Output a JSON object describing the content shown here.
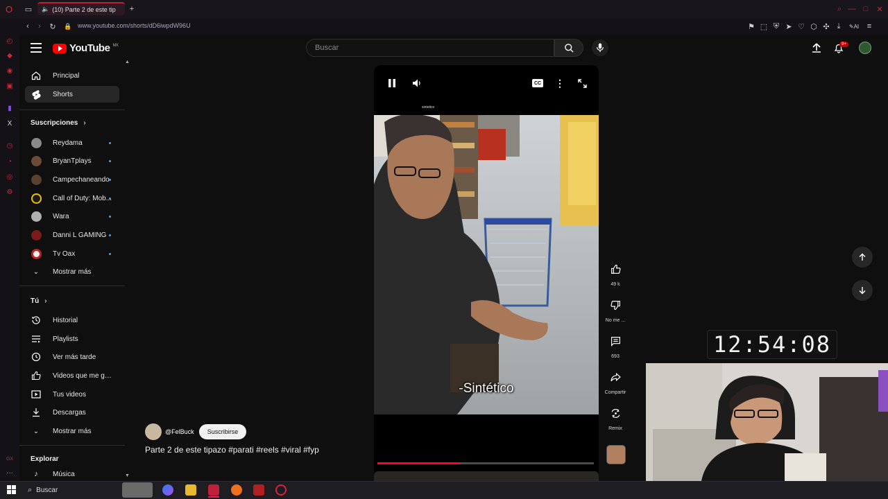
{
  "browser": {
    "tab_title": "(10) Parte 2 de este tip",
    "url": "www.youtube.com/shorts/dD6iwpdW96U"
  },
  "youtube": {
    "logo_text": "YouTube",
    "region": "MX",
    "search_placeholder": "Buscar",
    "notif_badge": "9+"
  },
  "sidebar": {
    "main": [
      {
        "label": "Principal",
        "icon": "home-icon"
      },
      {
        "label": "Shorts",
        "icon": "shorts-icon",
        "active": true
      }
    ],
    "subs_title": "Suscripciones",
    "subs": [
      {
        "label": "Reydama",
        "color": "#8a8a8a"
      },
      {
        "label": "BryanTplays",
        "color": "#6b4a3a"
      },
      {
        "label": "Campechaneando",
        "color": "#5a4030"
      },
      {
        "label": "Call of Duty: Mob...",
        "color": "#e8c400"
      },
      {
        "label": "Wara",
        "color": "#b0b0b0"
      },
      {
        "label": "Danni L GAMING",
        "color": "#7a1a1a"
      },
      {
        "label": "Tv Oax",
        "color": "#f0f0f0"
      }
    ],
    "show_more_1": "Mostrar más",
    "you_title": "Tú",
    "you": [
      {
        "label": "Historial",
        "icon": "history-icon"
      },
      {
        "label": "Playlists",
        "icon": "playlists-icon"
      },
      {
        "label": "Ver más tarde",
        "icon": "watch-later-icon"
      },
      {
        "label": "Videos que me gust...",
        "icon": "liked-icon"
      },
      {
        "label": "Tus videos",
        "icon": "your-videos-icon"
      },
      {
        "label": "Descargas",
        "icon": "downloads-icon"
      }
    ],
    "show_more_2": "Mostrar más",
    "explore_title": "Explorar",
    "explore": [
      {
        "label": "Música",
        "icon": "music-icon"
      }
    ]
  },
  "short": {
    "top_text": "sintetico",
    "caption": "-Sintético",
    "channel": "@FelBuck",
    "subscribe_label": "Suscribirse",
    "title": "Parte 2 de este tipazo #parati #reels #viral #fyp",
    "progress_fraction": 0.38,
    "actions": {
      "likes": "49 k",
      "dislike": "No me ...",
      "comments": "693",
      "share": "Compartir",
      "remix": "Remix"
    }
  },
  "overlay": {
    "clock": "12:54:08"
  },
  "taskbar": {
    "search_label": "Buscar"
  }
}
